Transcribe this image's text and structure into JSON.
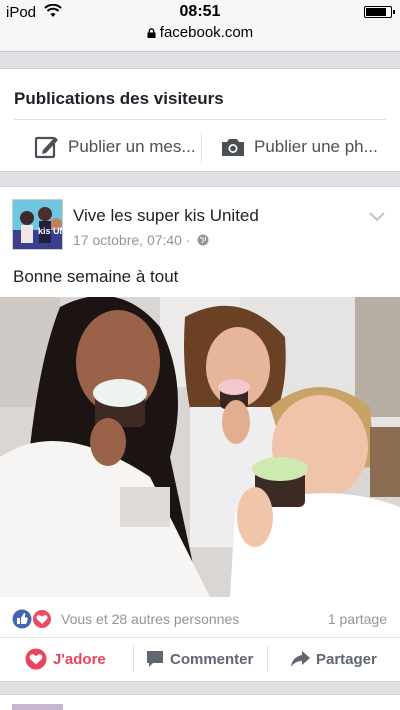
{
  "status_bar": {
    "carrier": "iPod",
    "time": "08:51",
    "battery_level": 0.85
  },
  "browser": {
    "url": "facebook.com"
  },
  "visitor_posts": {
    "title": "Publications des visiteurs",
    "write_post_label": "Publier un mes...",
    "photo_post_label": "Publier une ph..."
  },
  "post": {
    "author": "Vive les super kis United",
    "timestamp": "17 octobre, 07:40 ·",
    "text": "Bonne semaine à tout",
    "avatar_text": "kis UNITED",
    "reactions_text": "Vous et 28 autres personnes",
    "shares_text": "1 partage",
    "actions": {
      "like": "J'adore",
      "comment": "Commenter",
      "share": "Partager"
    }
  },
  "colors": {
    "facebook_blue": "#4267b2",
    "love_red": "#e9435e",
    "muted_gray": "#90949c"
  },
  "icons": [
    "wifi-icon",
    "lock-icon",
    "compose-icon",
    "camera-icon",
    "globe-icon",
    "chevron-down-icon",
    "like-reaction-icon",
    "love-reaction-icon",
    "heart-icon",
    "comment-icon",
    "share-arrow-icon"
  ]
}
